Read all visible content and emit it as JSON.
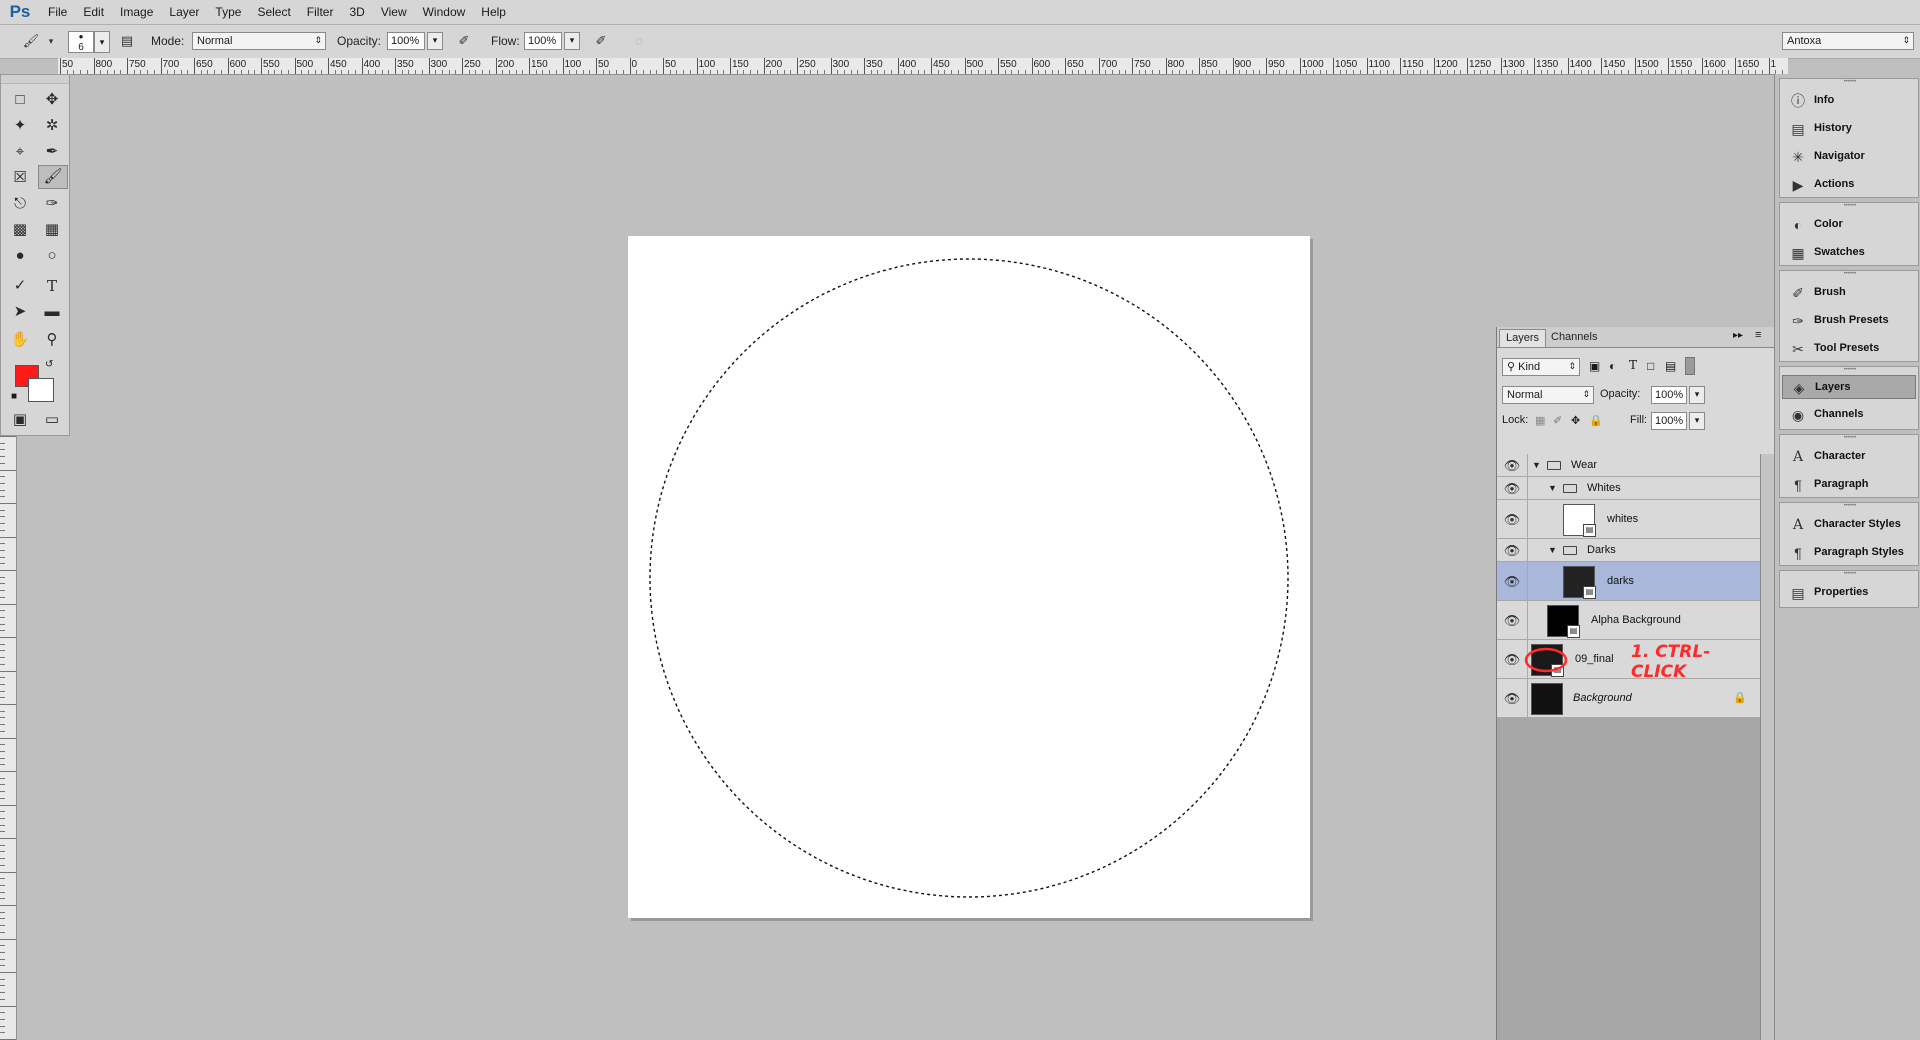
{
  "menubar": {
    "logo": "Ps",
    "items": [
      "File",
      "Edit",
      "Image",
      "Layer",
      "Type",
      "Select",
      "Filter",
      "3D",
      "View",
      "Window",
      "Help"
    ]
  },
  "options_bar": {
    "brush_size": "6",
    "mode_label": "Mode:",
    "mode_value": "Normal",
    "opacity_label": "Opacity:",
    "opacity_value": "100%",
    "flow_label": "Flow:",
    "flow_value": "100%",
    "workspace": "Antoxa"
  },
  "ruler": {
    "labels": [
      "50",
      "800",
      "750",
      "700",
      "650",
      "600",
      "550",
      "500",
      "450",
      "400",
      "350",
      "300",
      "250",
      "200",
      "150",
      "100",
      "50",
      "0",
      "50",
      "100",
      "150",
      "200",
      "250",
      "300",
      "350",
      "400",
      "450",
      "500",
      "550",
      "600",
      "650",
      "700",
      "750",
      "800",
      "850",
      "900",
      "950",
      "1000",
      "1050",
      "1100",
      "1150",
      "1200",
      "1250",
      "1300",
      "1350",
      "1400",
      "1450",
      "1500",
      "1550",
      "1600",
      "1650",
      "1"
    ]
  },
  "toolbox": {
    "tools": [
      "marquee-tool",
      "move-tool",
      "lasso-tool",
      "magic-wand-tool",
      "crop-tool",
      "eyedropper-tool",
      "healing-brush-tool",
      "brush-tool",
      "clone-stamp-tool",
      "history-brush-tool",
      "eraser-tool",
      "gradient-tool",
      "blur-tool",
      "dodge-tool",
      "pen-tool",
      "type-tool",
      "path-selection-tool",
      "rectangle-tool",
      "hand-tool",
      "zoom-tool"
    ],
    "foreground_color": "#ff1a1a",
    "background_color": "#ffffff"
  },
  "layers_panel": {
    "tabs": [
      "Layers",
      "Channels"
    ],
    "filter_label": "Kind",
    "blend_mode": "Normal",
    "opacity_label": "Opacity:",
    "opacity_value": "100%",
    "lock_label": "Lock:",
    "fill_label": "Fill:",
    "fill_value": "100%",
    "layers": [
      {
        "name": "Wear",
        "type": "group"
      },
      {
        "name": "Whites",
        "type": "group"
      },
      {
        "name": "whites",
        "type": "layer"
      },
      {
        "name": "Darks",
        "type": "group"
      },
      {
        "name": "darks",
        "type": "layer",
        "selected": true
      },
      {
        "name": "Alpha Background",
        "type": "layer"
      },
      {
        "name": "09_final",
        "type": "layer"
      },
      {
        "name": "Background",
        "type": "layer",
        "locked": true
      }
    ],
    "annotation": "1. CTRL-CLICK"
  },
  "dock": {
    "groups": [
      [
        {
          "label": "Info",
          "icon": "info-icon"
        },
        {
          "label": "History",
          "icon": "history-icon"
        },
        {
          "label": "Navigator",
          "icon": "navigator-icon"
        },
        {
          "label": "Actions",
          "icon": "actions-icon"
        }
      ],
      [
        {
          "label": "Color",
          "icon": "color-icon"
        },
        {
          "label": "Swatches",
          "icon": "swatches-icon"
        }
      ],
      [
        {
          "label": "Brush",
          "icon": "brush-icon"
        },
        {
          "label": "Brush Presets",
          "icon": "brush-presets-icon"
        },
        {
          "label": "Tool Presets",
          "icon": "tool-presets-icon"
        }
      ],
      [
        {
          "label": "Layers",
          "icon": "layers-icon",
          "active": true
        },
        {
          "label": "Channels",
          "icon": "channels-icon"
        }
      ],
      [
        {
          "label": "Character",
          "icon": "character-icon"
        },
        {
          "label": "Paragraph",
          "icon": "paragraph-icon"
        }
      ],
      [
        {
          "label": "Character Styles",
          "icon": "character-styles-icon"
        },
        {
          "label": "Paragraph Styles",
          "icon": "paragraph-styles-icon"
        }
      ],
      [
        {
          "label": "Properties",
          "icon": "properties-icon"
        }
      ]
    ]
  },
  "colors": {
    "selection_highlight": "#a9b8da",
    "annotation": "#ff2a2a"
  }
}
